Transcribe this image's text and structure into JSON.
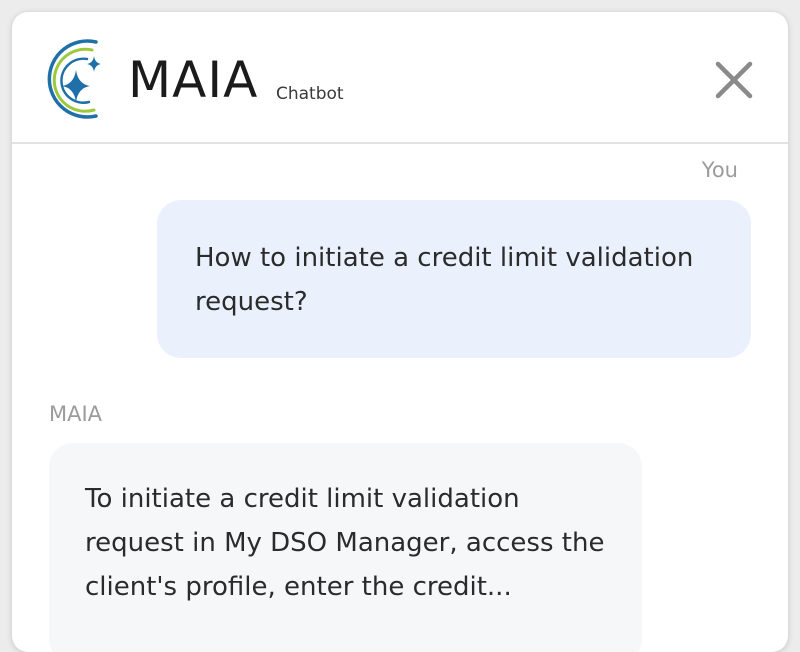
{
  "header": {
    "title": "MAIA",
    "subtitle": "Chatbot",
    "logo_icon": "sparkle-icon",
    "close_icon": "close-icon"
  },
  "colors": {
    "logo_blue": "#1f6fa8",
    "logo_green": "#9cc93b",
    "user_bubble": "#eaf1fd",
    "bot_bubble": "#f6f7f9",
    "close_icon": "#8a8a8a"
  },
  "conversation": {
    "messages": [
      {
        "sender": "You",
        "text": "How to initiate a credit limit validation request?"
      },
      {
        "sender": "MAIA",
        "text": "To initiate a credit limit validation request in My DSO Manager, access the client's profile, enter the credit..."
      }
    ]
  }
}
